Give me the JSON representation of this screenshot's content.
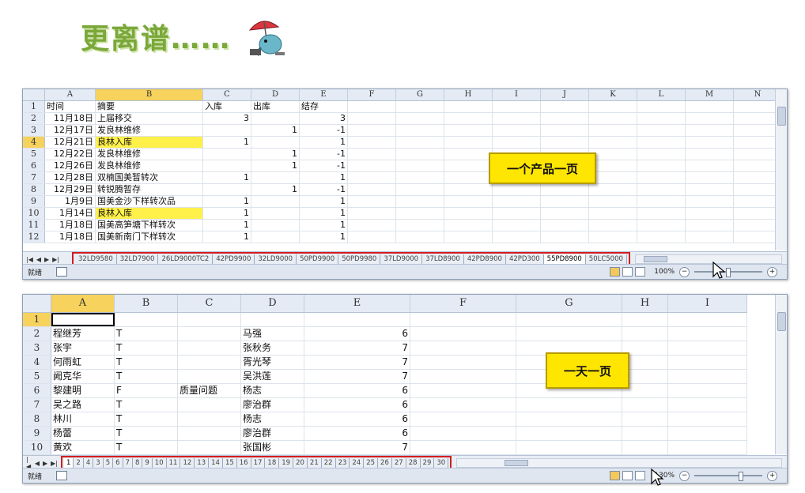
{
  "heading": {
    "text": "更离谱……",
    "mascot": "elephant-with-umbrella"
  },
  "top_sheet": {
    "columns": [
      "A",
      "B",
      "C",
      "D",
      "E",
      "F",
      "G",
      "H",
      "I",
      "J",
      "K",
      "L",
      "M",
      "N"
    ],
    "selected_column": "B",
    "rows": [
      {
        "n": "1",
        "cells": [
          "时间",
          "摘要",
          "入库",
          "出库",
          "结存"
        ]
      },
      {
        "n": "2",
        "cells": [
          "11月18日",
          "上届移交",
          "3",
          "",
          "3"
        ]
      },
      {
        "n": "3",
        "cells": [
          "12月17日",
          "发良林维修",
          "",
          "1",
          "-1"
        ]
      },
      {
        "n": "4",
        "cells": [
          "12月21日",
          "良林入库",
          "1",
          "",
          "1"
        ],
        "highlight": true
      },
      {
        "n": "5",
        "cells": [
          "12月22日",
          "发良林维修",
          "",
          "1",
          "-1"
        ]
      },
      {
        "n": "6",
        "cells": [
          "12月26日",
          "发良林维修",
          "",
          "1",
          "-1"
        ]
      },
      {
        "n": "7",
        "cells": [
          "12月28日",
          "双楠国美暂转次",
          "1",
          "",
          "1"
        ]
      },
      {
        "n": "8",
        "cells": [
          "12月29日",
          "转锐腾暂存",
          "",
          "1",
          "-1"
        ]
      },
      {
        "n": "9",
        "cells": [
          "1月9日",
          "国美金沙下样转次品",
          "1",
          "",
          "1"
        ]
      },
      {
        "n": "10",
        "cells": [
          "1月14日",
          "良林入库",
          "1",
          "",
          "1"
        ],
        "highlight": true
      },
      {
        "n": "11",
        "cells": [
          "1月18日",
          "国美高笋塘下样转次",
          "1",
          "",
          "1"
        ]
      },
      {
        "n": "12",
        "cells": [
          "1月18日",
          "国美新南门下样转次",
          "1",
          "",
          "1"
        ]
      }
    ],
    "tabs": [
      "32LD9580",
      "32LD7900",
      "26LD9000TC2",
      "42PD9900",
      "32LD9000",
      "50PD9900",
      "50PD9980",
      "37LD9000",
      "37LD8900",
      "42PD8900",
      "42PD300",
      "55PD8900",
      "50LC5000"
    ],
    "active_tab": "55PD8900",
    "callout": "一个产品一页",
    "status": "就绪",
    "zoom": "100%"
  },
  "bottom_sheet": {
    "columns": [
      "A",
      "B",
      "C",
      "D",
      "E",
      "F",
      "G",
      "H",
      "I"
    ],
    "selected_column": "A",
    "rows": [
      {
        "n": "1",
        "cells": [
          "",
          "",
          "",
          "",
          ""
        ]
      },
      {
        "n": "2",
        "cells": [
          "程继芳",
          "T",
          "",
          "马强",
          "6"
        ]
      },
      {
        "n": "3",
        "cells": [
          "张宇",
          "T",
          "",
          "张秋务",
          "7"
        ]
      },
      {
        "n": "4",
        "cells": [
          "何雨虹",
          "T",
          "",
          "胥光琴",
          "7"
        ]
      },
      {
        "n": "5",
        "cells": [
          "阙克华",
          "T",
          "",
          "吴洪莲",
          "7"
        ]
      },
      {
        "n": "6",
        "cells": [
          "黎建明",
          "F",
          "质量问题",
          "杨志",
          "6"
        ]
      },
      {
        "n": "7",
        "cells": [
          "吴之路",
          "T",
          "",
          "廖治群",
          "6"
        ]
      },
      {
        "n": "8",
        "cells": [
          "林川",
          "T",
          "",
          "杨志",
          "6"
        ]
      },
      {
        "n": "9",
        "cells": [
          "杨蕾",
          "T",
          "",
          "廖治群",
          "6"
        ]
      },
      {
        "n": "10",
        "cells": [
          "黄欢",
          "T",
          "",
          "张国彬",
          "7"
        ]
      }
    ],
    "tabs": [
      "1",
      "2",
      "4",
      "3",
      "5",
      "6",
      "7",
      "8",
      "9",
      "10",
      "11",
      "12",
      "13",
      "14",
      "15",
      "16",
      "17",
      "18",
      "19",
      "20",
      "21",
      "22",
      "23",
      "24",
      "25",
      "26",
      "27",
      "28",
      "29",
      "30"
    ],
    "active_tab": "1",
    "callout": "一天一页",
    "status": "就绪",
    "zoom": "130%"
  },
  "colors": {
    "highlight": "#fff04a",
    "selected_header": "#f7d25c",
    "callout": "#ffe600",
    "tab_frame": "#d21d1d"
  }
}
